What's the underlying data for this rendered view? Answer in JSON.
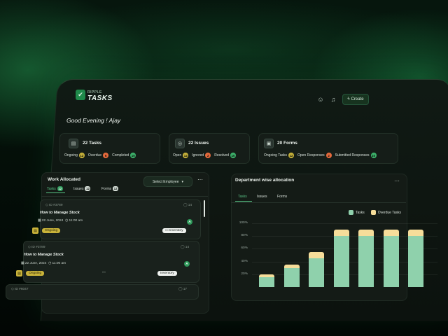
{
  "app": {
    "logo_top": "RIPPLE",
    "logo_main": "TASKS",
    "create_label": "Create"
  },
  "colors": {
    "accent": "#2f9a5b",
    "tasks_bar": "#8fd1ac",
    "overdue_bar": "#f6dd9a",
    "ongoing_dot": "#c9b33a",
    "overdue_dot": "#e66a3c",
    "completed_dot": "#3db26b"
  },
  "greeting": "Good Evening ! Ajay",
  "summary": {
    "tasks": {
      "title": "22 Tasks",
      "ongoing_label": "Ongoing",
      "ongoing": "12",
      "overdue_label": "Overdue",
      "overdue": "5",
      "completed_label": "Completed",
      "completed": "10"
    },
    "issues": {
      "title": "22 Issues",
      "open_label": "Open",
      "open": "12",
      "ignored_label": "Ignored",
      "ignored": "2",
      "resolved_label": "Resolved",
      "resolved": "10"
    },
    "forms": {
      "title": "20 Forms",
      "ongoing_label": "Ongoing Tasks",
      "ongoing": "12",
      "open_label": "Open Responses",
      "open": "2",
      "submitted_label": "Submitted Responses",
      "submitted": "10"
    }
  },
  "work": {
    "title": "Work Allocated",
    "select_label": "Select Employee",
    "tabs": [
      {
        "label": "Tasks",
        "count": "12"
      },
      {
        "label": "Issues",
        "count": "12"
      },
      {
        "label": "Forms",
        "count": "12"
      }
    ],
    "items": [
      {
        "id": "ID #3789",
        "comments": "14",
        "title": "How to Manage Stock",
        "date": "22 June, 2024",
        "time": "11:00 am",
        "status": "Ongoing",
        "category": "Inventory",
        "assignee": "A"
      },
      {
        "id": "ID #3789",
        "comments": "14",
        "title": "How to Manage Stock",
        "date": "22 June, 2024",
        "time": "11:00 am",
        "status": "Ongoing",
        "category": "Inventory",
        "assignee": "A"
      },
      {
        "id": "ID #6047",
        "comments": "17"
      }
    ]
  },
  "department": {
    "title": "Department wise allocation",
    "tabs": [
      "Tasks",
      "Issues",
      "Forms"
    ],
    "legend": [
      "Tasks",
      "Overdue Tasks"
    ]
  },
  "chart_data": {
    "type": "bar",
    "stacked": true,
    "ylabels": [
      "100%",
      "80%",
      "60%",
      "40%",
      "20%"
    ],
    "ylim": [
      0,
      100
    ],
    "series": [
      {
        "name": "Tasks",
        "values": [
          15,
          30,
          45,
          80,
          80,
          80,
          80
        ]
      },
      {
        "name": "Overdue Tasks",
        "values": [
          5,
          5,
          10,
          10,
          10,
          10,
          10
        ]
      }
    ],
    "grid": true,
    "legend_position": "top-right"
  }
}
